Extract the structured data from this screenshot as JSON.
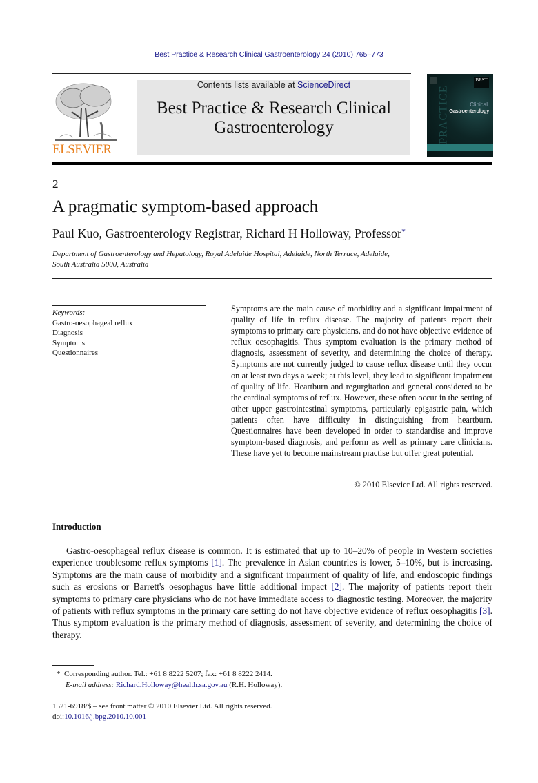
{
  "header": {
    "journal_citation": "Best Practice & Research Clinical Gastroenterology 24 (2010) 765–773",
    "contents_prefix": "Contents lists available at ",
    "contents_link": "ScienceDirect",
    "journal_title_line1": "Best Practice & Research Clinical",
    "journal_title_line2": "Gastroenterology",
    "publisher_wordmark": "ELSEVIER",
    "cover": {
      "badge": "BEST",
      "spine_text": "PRACTICE",
      "title_small": "Clinical",
      "title_main": "Gastroenterology"
    }
  },
  "article": {
    "chapter_number": "2",
    "title": "A pragmatic symptom-based approach",
    "authors": "Paul Kuo, Gastroenterology Registrar, Richard H Holloway, Professor",
    "author_marker": "*",
    "affiliation_line1": "Department of Gastroenterology and Hepatology, Royal Adelaide Hospital, Adelaide, North Terrace, Adelaide,",
    "affiliation_line2": "South Australia 5000, Australia"
  },
  "keywords": {
    "label": "Keywords:",
    "items": [
      "Gastro-oesophageal reflux",
      "Diagnosis",
      "Symptoms",
      "Questionnaires"
    ]
  },
  "abstract": {
    "text": "Symptoms are the main cause of morbidity and a significant impairment of quality of life in reflux disease. The majority of patients report their symptoms to primary care physicians, and do not have objective evidence of reflux oesophagitis. Thus symptom evaluation is the primary method of diagnosis, assessment of severity, and determining the choice of therapy. Symptoms are not currently judged to cause reflux disease until they occur on at least two days a week; at this level, they lead to significant impairment of quality of life. Heartburn and regurgitation and general considered to be the cardinal symptoms of reflux. However, these often occur in the setting of other upper gastrointestinal symptoms, particularly epigastric pain, which patients often have difficulty in dis­tinguishing from heartburn. Questionnaires have been developed in order to standardise and improve symptom-based diagnosis, and perform as well as primary care clinicians. These have yet to become mainstream practise but offer great potential.",
    "copyright": "© 2010 Elsevier Ltd. All rights reserved."
  },
  "introduction": {
    "heading": "Introduction",
    "seg1": "Gastro-oesophageal reflux disease is common. It is estimated that up to 10–20% of people in Western societies experience troublesome reflux symptoms ",
    "ref1": "[1]",
    "seg2": ". The prevalence in Asian countries is lower, 5–10%, but is increasing. Symptoms are the main cause of morbidity and a significant impairment of quality of life, and endoscopic findings such as erosions or Barrett's oesophagus have little additional impact ",
    "ref2": "[2]",
    "seg3": ". The majority of patients report their symptoms to primary care physicians who do not have immediate access to diagnostic testing. Moreover, the majority of patients with reflux symptoms in the primary care setting do not have objective evidence of reflux oesophagitis ",
    "ref3": "[3]",
    "seg4": ". Thus symptom evaluation is the primary method of diagnosis, assessment of severity, and determining the choice of therapy."
  },
  "footnote": {
    "marker": "*",
    "corresponding": "Corresponding author. Tel.: +61 8 8222 5207; fax: +61 8 8222 2414.",
    "email_label": "E-mail address:",
    "email": "Richard.Holloway@health.sa.gov.au",
    "email_suffix": "(R.H. Holloway)."
  },
  "front_matter": {
    "issn_line": "1521-6918/$ – see front matter © 2010 Elsevier Ltd. All rights reserved.",
    "doi_prefix": "doi:",
    "doi": "10.1016/j.bpg.2010.10.001"
  },
  "colors": {
    "link": "#1a1a8c",
    "elsevier_orange": "#e8801f",
    "masthead_grey": "#e6e6e6",
    "cover_teal": "#2a7b78"
  }
}
